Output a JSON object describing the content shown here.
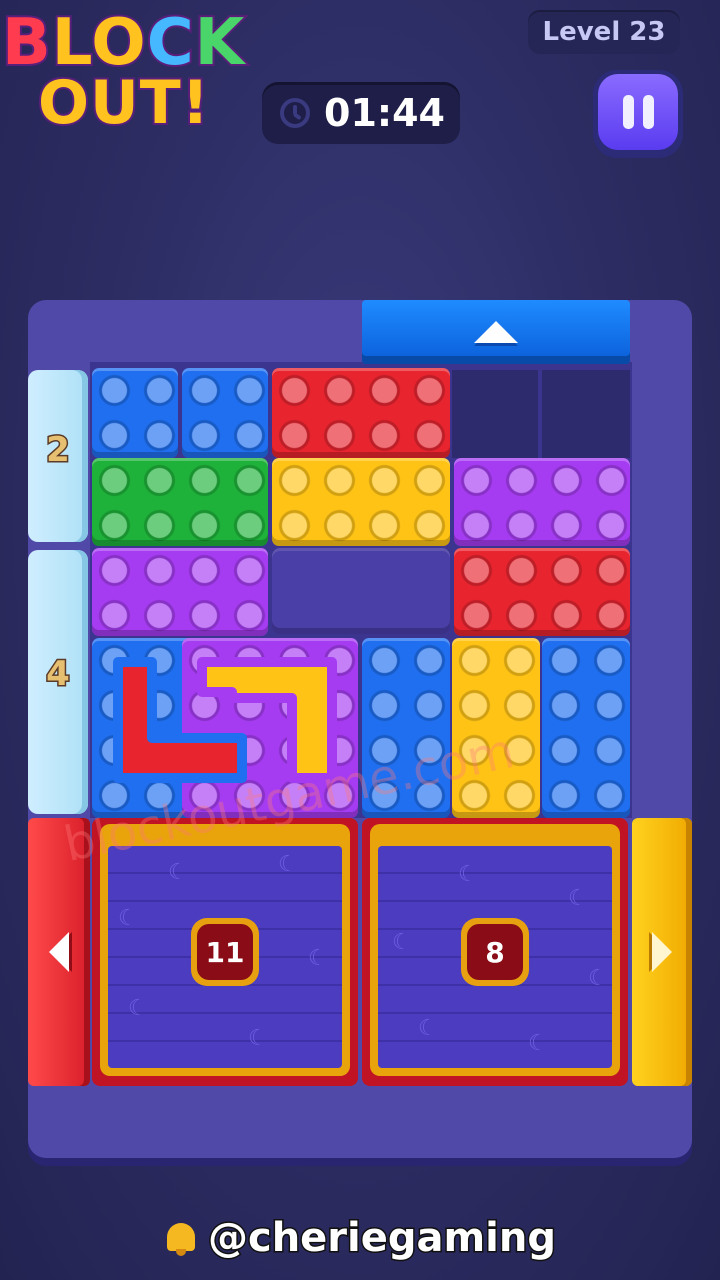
{
  "header": {
    "logo_line1": [
      "B",
      "L",
      "O",
      "C",
      "K"
    ],
    "logo_line2": "OUT!",
    "level_label": "Level 23",
    "timer_value": "01:44",
    "pause_icon": "pause-icon"
  },
  "board": {
    "gates": {
      "top_arrow": "arrow-up-icon",
      "left_gate_1_count": "2",
      "left_gate_2_count": "4",
      "red_arrow": "arrow-left-icon",
      "yellow_arrow": "arrow-right-icon"
    },
    "crates": [
      {
        "count": "11"
      },
      {
        "count": "8"
      }
    ],
    "watermark": "blockoutgame.com"
  },
  "footer": {
    "handle": "@cheriegaming",
    "icon": "bell-icon"
  },
  "colors": {
    "blue": "#1f6ff0",
    "red": "#e8242f",
    "green": "#1eb23a",
    "yellow": "#ffc316",
    "purple": "#a63cf2",
    "background": "#2c2c62"
  }
}
